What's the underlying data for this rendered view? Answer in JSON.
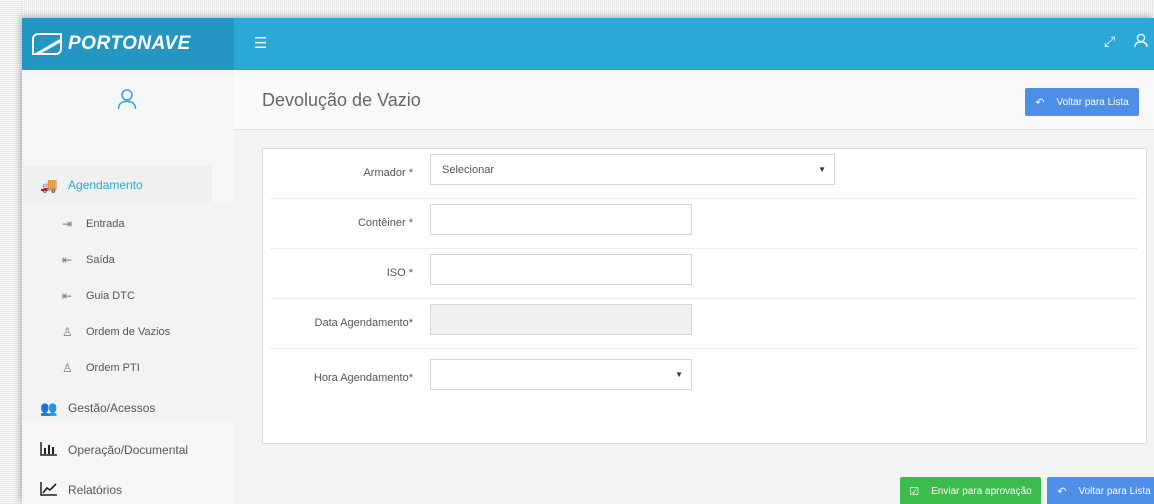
{
  "brand": {
    "name": "PORTONAVE"
  },
  "topbar": {
    "menu_icon": "hamburger-icon",
    "expand_icon": "expand-icon",
    "user_icon": "user-icon"
  },
  "sidebar": {
    "avatar_icon": "user-outline-icon",
    "sections": [
      {
        "label": "Agendamento",
        "icon": "truck-icon",
        "active": true
      },
      {
        "label": "Gestão/Acessos",
        "icon": "users-icon"
      },
      {
        "label": "Operação/Documental",
        "icon": "bar-chart-icon"
      },
      {
        "label": "Relatórios",
        "icon": "line-chart-icon"
      }
    ],
    "submenu": [
      {
        "label": "Entrada",
        "icon": "sign-in-icon"
      },
      {
        "label": "Saída",
        "icon": "sign-out-icon"
      },
      {
        "label": "Guia DTC",
        "icon": "sign-out-icon"
      },
      {
        "label": "Ordem de Vazios",
        "icon": "user-group-icon"
      },
      {
        "label": "Ordem PTI",
        "icon": "user-group-icon"
      }
    ]
  },
  "page": {
    "title": "Devolução de Vazio",
    "back_label": "Voltar para Lista"
  },
  "form": {
    "armador_label": "Armador *",
    "armador_value": "Selecionar",
    "conteiner_label": "Contêiner *",
    "conteiner_value": "",
    "iso_label": "ISO *",
    "iso_value": "",
    "data_label": "Data Agendamento*",
    "data_value": "",
    "hora_label": "Hora Agendamento*",
    "hora_value": ""
  },
  "actions": {
    "send_label": "Enviar para aprovação",
    "back_label": "Voltar para Lista"
  },
  "colors": {
    "topbar": "#2aa8d6",
    "brand_bg": "#2496c4",
    "button_blue": "#4d8ee6",
    "button_green": "#3dbb4c"
  }
}
